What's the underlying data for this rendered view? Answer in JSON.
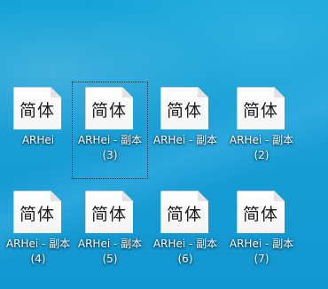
{
  "desktop": {
    "icons": [
      {
        "glyph": "简体",
        "label_line1": "ARHei",
        "label_line2": ""
      },
      {
        "glyph": "简体",
        "label_line1": "ARHei - 副本",
        "label_line2": "(3)"
      },
      {
        "glyph": "简体",
        "label_line1": "ARHei - 副本",
        "label_line2": ""
      },
      {
        "glyph": "简体",
        "label_line1": "ARHei - 副本",
        "label_line2": "(2)"
      },
      {
        "glyph": "简体",
        "label_line1": "ARHei - 副本",
        "label_line2": "(4)"
      },
      {
        "glyph": "简体",
        "label_line1": "ARHei - 副本",
        "label_line2": "(5)"
      },
      {
        "glyph": "简体",
        "label_line1": "ARHei - 副本",
        "label_line2": "(6)"
      },
      {
        "glyph": "简体",
        "label_line1": "ARHei - 副本",
        "label_line2": "(7)"
      }
    ],
    "selected_index": 1,
    "icon_type": "font-file-icon"
  }
}
